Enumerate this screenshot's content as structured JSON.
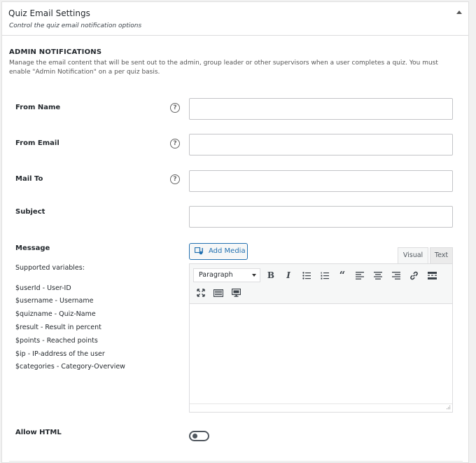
{
  "panel": {
    "title": "Quiz Email Settings",
    "subtitle": "Control the quiz email notification options"
  },
  "section": {
    "title": "ADMIN NOTIFICATIONS",
    "description": "Manage the email content that will be sent out to the admin, group leader or other supervisors when a user completes a quiz. You must enable \"Admin Notification\" on a per quiz basis."
  },
  "fields": {
    "from_name": {
      "label": "From Name",
      "value": ""
    },
    "from_email": {
      "label": "From Email",
      "value": ""
    },
    "mail_to": {
      "label": "Mail To",
      "value": ""
    },
    "subject": {
      "label": "Subject",
      "value": ""
    },
    "help_glyph": "?"
  },
  "message": {
    "label": "Message",
    "supported_label": "Supported variables:",
    "variables": [
      "$userId - User-ID",
      "$username - Username",
      "$quizname - Quiz-Name",
      "$result - Result in percent",
      "$points - Reached points",
      "$ip - IP-address of the user",
      "$categories - Category-Overview"
    ]
  },
  "editor": {
    "add_media": "Add Media",
    "tab_visual": "Visual",
    "tab_text": "Text",
    "format": "Paragraph",
    "bold": "B",
    "italic": "I",
    "quote": "“",
    "icons": [
      "bold-icon",
      "italic-icon",
      "bullet-list-icon",
      "numbered-list-icon",
      "blockquote-icon",
      "align-left-icon",
      "align-center-icon",
      "align-right-icon",
      "link-icon",
      "read-more-icon",
      "fullscreen-icon",
      "keyboard-toolbar-icon",
      "monitor-icon"
    ]
  },
  "allow_html": {
    "label": "Allow HTML",
    "enabled": false
  },
  "colors": {
    "accent": "#2271b1",
    "border": "#dcdcde",
    "text": "#23282d"
  }
}
